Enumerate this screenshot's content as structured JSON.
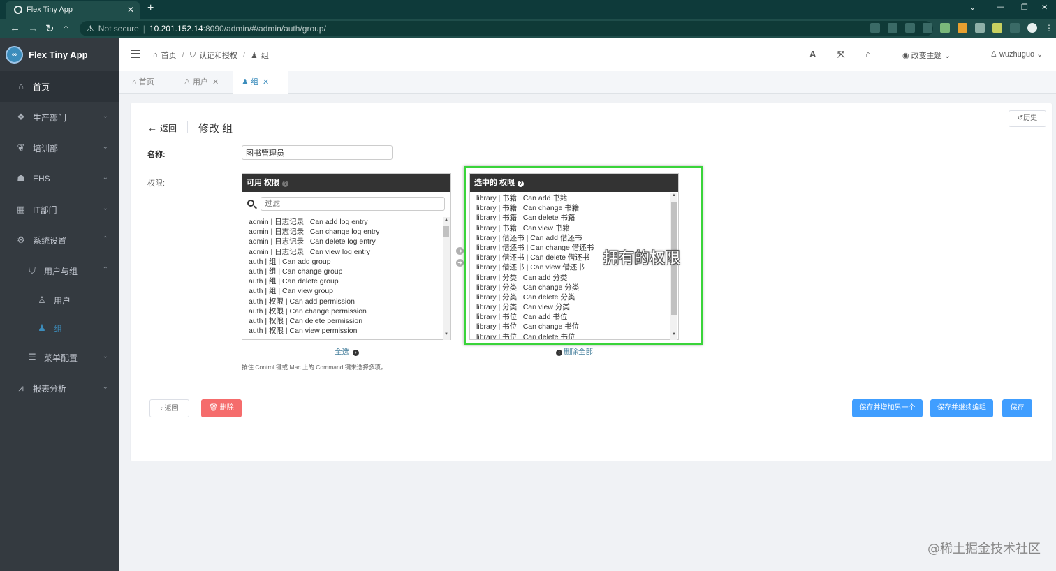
{
  "browser": {
    "tab_title": "Flex Tiny App",
    "security_label": "Not secure",
    "url_host": "10.201.152.14",
    "url_path": ":8090/admin/#/admin/auth/group/"
  },
  "sidebar": {
    "brand": "Flex Tiny App",
    "brand_logo": "∞",
    "items": [
      {
        "label": "首页"
      },
      {
        "label": "生产部门"
      },
      {
        "label": "培训部"
      },
      {
        "label": "EHS"
      },
      {
        "label": "IT部门"
      },
      {
        "label": "系统设置"
      },
      {
        "label": "用户与组"
      },
      {
        "label": "用户"
      },
      {
        "label": "组"
      },
      {
        "label": "菜单配置"
      },
      {
        "label": "报表分析"
      }
    ]
  },
  "header": {
    "breadcrumb": [
      "首页",
      "认证和授权",
      "组"
    ],
    "font_icon_label": "A",
    "theme_label": "改变主题",
    "username": "wuzhuguo"
  },
  "tabs": [
    {
      "label": "首页"
    },
    {
      "label": "用户"
    },
    {
      "label": "组"
    }
  ],
  "form": {
    "history_label": "历史",
    "back_label": "返回",
    "title": "修改 组",
    "name_label": "名称:",
    "name_value": "图书管理员",
    "perm_label": "权限:",
    "available_title": "可用 权限",
    "filter_placeholder": "过滤",
    "available": [
      "admin | 日志记录 | Can add log entry",
      "admin | 日志记录 | Can change log entry",
      "admin | 日志记录 | Can delete log entry",
      "admin | 日志记录 | Can view log entry",
      "auth | 组 | Can add group",
      "auth | 组 | Can change group",
      "auth | 组 | Can delete group",
      "auth | 组 | Can view group",
      "auth | 权限 | Can add permission",
      "auth | 权限 | Can change permission",
      "auth | 权限 | Can delete permission",
      "auth | 权限 | Can view permission"
    ],
    "chosen_title": "选中的 权限",
    "chosen": [
      "library | 书籍 | Can add 书籍",
      "library | 书籍 | Can change 书籍",
      "library | 书籍 | Can delete 书籍",
      "library | 书籍 | Can view 书籍",
      "library | 借还书 | Can add 借还书",
      "library | 借还书 | Can change 借还书",
      "library | 借还书 | Can delete 借还书",
      "library | 借还书 | Can view 借还书",
      "library | 分类 | Can add 分类",
      "library | 分类 | Can change 分类",
      "library | 分类 | Can delete 分类",
      "library | 分类 | Can view 分类",
      "library | 书位 | Can add 书位",
      "library | 书位 | Can change 书位",
      "library | 书位 | Can delete 书位"
    ],
    "choose_all_label": "全选",
    "remove_all_label": "删除全部",
    "help_text": "按住 Control 键或 Mac 上的 Command 键来选择多项。",
    "annotation": "拥有的权限"
  },
  "actions": {
    "back": "返回",
    "delete": "删除",
    "save_add_another": "保存并增加另一个",
    "save_continue": "保存并继续编辑",
    "save": "保存"
  },
  "watermark": "@稀土掘金技术社区",
  "colors": {
    "sidebar_bg": "#343a40",
    "accent": "#409eff",
    "danger": "#f56c6c",
    "highlight": "#3ad43a"
  }
}
